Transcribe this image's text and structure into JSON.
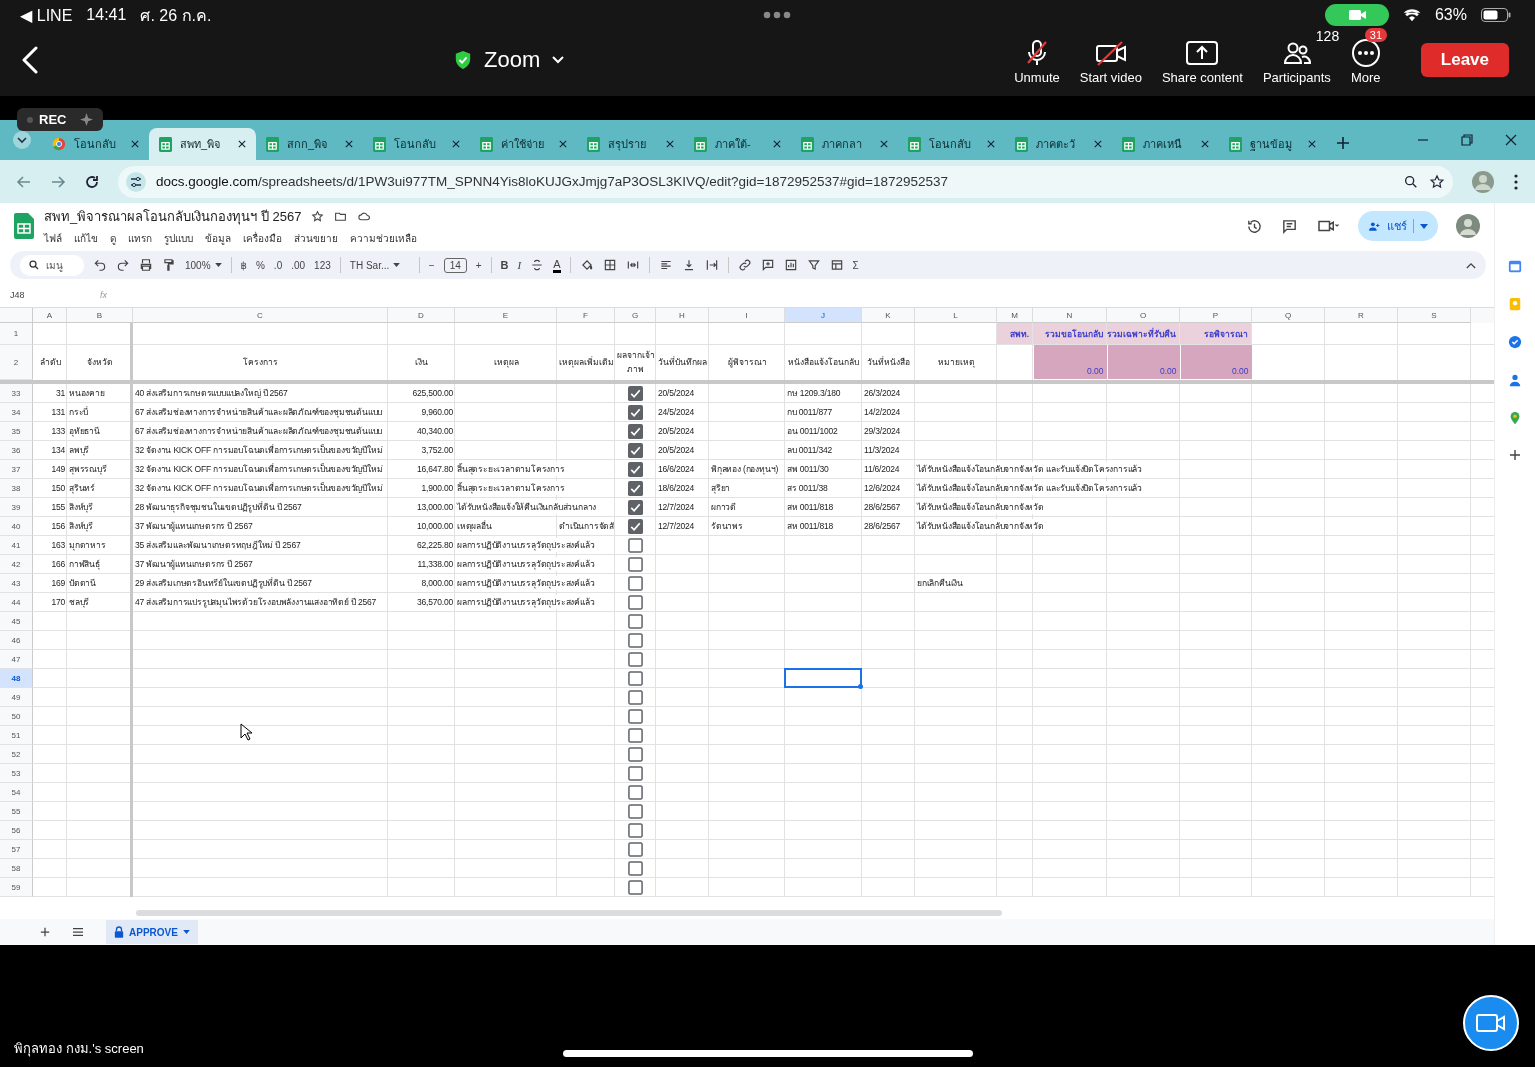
{
  "status_bar": {
    "back_app": "◀ LINE",
    "time": "14:41",
    "date": "ศ. 26 ก.ค.",
    "battery": "63%"
  },
  "zoom_bar": {
    "title": "Zoom",
    "controls": [
      {
        "kind": "mic",
        "label": "Unmute",
        "off": true
      },
      {
        "kind": "video",
        "label": "Start video",
        "off": true
      },
      {
        "kind": "share",
        "label": "Share content",
        "off": false
      },
      {
        "kind": "participants",
        "label": "Participants",
        "count": "128",
        "off": false
      },
      {
        "kind": "more",
        "label": "More",
        "badge": "31",
        "off": false
      }
    ],
    "leave": "Leave"
  },
  "rec_badge": "REC",
  "browser": {
    "tabs": [
      {
        "title": "โอนกลับ",
        "selected": false,
        "kind": "web"
      },
      {
        "title": "สพท_พิจ",
        "selected": true,
        "kind": "sheet"
      },
      {
        "title": "สกก_พิจ",
        "selected": false,
        "kind": "sheet"
      },
      {
        "title": "โอนกลับ",
        "selected": false,
        "kind": "sheet"
      },
      {
        "title": "ค่าใช้จ่าย",
        "selected": false,
        "kind": "sheet"
      },
      {
        "title": "สรุปราย",
        "selected": false,
        "kind": "sheet"
      },
      {
        "title": "ภาคใต้-",
        "selected": false,
        "kind": "sheet"
      },
      {
        "title": "ภาคกลา",
        "selected": false,
        "kind": "sheet"
      },
      {
        "title": "โอนกลับ",
        "selected": false,
        "kind": "sheet"
      },
      {
        "title": "ภาคตะวั",
        "selected": false,
        "kind": "sheet"
      },
      {
        "title": "ภาคเหนื",
        "selected": false,
        "kind": "sheet"
      },
      {
        "title": "ฐานข้อมู",
        "selected": false,
        "kind": "sheet"
      }
    ],
    "url_host": "docs.google.com",
    "url_path": "/spreadsheets/d/1PW3ui977TM_SPNN4Yis8loKUJGxJmjg7aP3OSL3KIVQ/edit?gid=1872952537#gid=1872952537"
  },
  "sheet": {
    "title": "สพท_พิจารณาผลโอนกลับเงินกองทุนฯ ปี 2567",
    "menu": [
      "ไฟล์",
      "แก้ไข",
      "ดู",
      "แทรก",
      "รูปแบบ",
      "ข้อมูล",
      "เครื่องมือ",
      "ส่วนขยาย",
      "ความช่วยเหลือ"
    ],
    "share": "แชร์",
    "toolbar": {
      "search": "เมนู",
      "zoom": "100%",
      "currency": "฿",
      "percent": "%",
      "dec_less": ".0",
      "dec_more": ".00",
      "format": "123",
      "font": "TH Sar...",
      "minus": "−",
      "size": "14",
      "plus": "+",
      "bold": "B",
      "italic": "I",
      "color_letter": "A",
      "functions": "Σ"
    },
    "name_box": "J48",
    "fx": "fx",
    "columns": [
      {
        "letter": "A",
        "selected": false,
        "kind": "number"
      },
      {
        "letter": "B",
        "selected": false,
        "kind": "text"
      },
      {
        "letter": "C",
        "selected": false,
        "kind": "text"
      },
      {
        "letter": "D",
        "selected": false,
        "kind": "number"
      },
      {
        "letter": "E",
        "selected": false,
        "kind": "text"
      },
      {
        "letter": "F",
        "selected": false,
        "kind": "text"
      },
      {
        "letter": "G",
        "selected": false,
        "kind": "checkbox"
      },
      {
        "letter": "H",
        "selected": false,
        "kind": "text"
      },
      {
        "letter": "I",
        "selected": false,
        "kind": "text"
      },
      {
        "letter": "J",
        "selected": true,
        "kind": "text"
      },
      {
        "letter": "K",
        "selected": false,
        "kind": "text"
      },
      {
        "letter": "L",
        "selected": false,
        "kind": "text"
      },
      {
        "letter": "M",
        "selected": false,
        "kind": "text"
      },
      {
        "letter": "N",
        "selected": false,
        "kind": "text"
      },
      {
        "letter": "O",
        "selected": false,
        "kind": "text"
      },
      {
        "letter": "P",
        "selected": false,
        "kind": "text"
      },
      {
        "letter": "Q",
        "selected": false,
        "kind": "text"
      },
      {
        "letter": "R",
        "selected": false,
        "kind": "text"
      },
      {
        "letter": "S",
        "selected": false,
        "kind": "text"
      }
    ],
    "header_row_numbers": [
      "1",
      "2"
    ],
    "summary_labels": {
      "M": "สพท.",
      "N": "รวมขอโอนกลับ",
      "O": "รวมเฉพาะที่รับคืน",
      "P": "รอพิจารณา"
    },
    "headings": {
      "A": "ลำดับ",
      "B": "จังหวัด",
      "C": "โครงการ",
      "D": "เงิน",
      "E": "เหตุผล",
      "F": "เหตุผลเพิ่มเติม",
      "G": "ผลจากเจ้า ภาพ",
      "H": "วันที่บันทึกผล",
      "I": "ผู้พิจารณา",
      "J": "หนังสือแจ้งโอนกลับ",
      "K": "วันที่หนังสือ",
      "L": "หมายเหตุ"
    },
    "summary_totals": {
      "N": "0.00",
      "O": "0.00",
      "P": "0.00"
    },
    "rows": [
      {
        "number": "33",
        "selected": false,
        "checked": true,
        "cells": {
          "A": "31",
          "B": "หนองคาย",
          "C": "40 ส่งเสริมการเกษตรแบบแปลงใหญ่ ปี 2567",
          "D": "625,500.00",
          "H": "20/5/2024",
          "J": "กษ 1209.3/180",
          "K": "26/3/2024"
        }
      },
      {
        "number": "34",
        "selected": false,
        "checked": true,
        "cells": {
          "A": "131",
          "B": "กระบี่",
          "C": "67 ส่งเสริมช่องทางการจำหน่ายสินค้าและผลิตภัณฑ์ของชุมชนต้นแบบ",
          "D": "9,960.00",
          "H": "24/5/2024",
          "J": "กบ 0011/877",
          "K": "14/2/2024"
        }
      },
      {
        "number": "35",
        "selected": false,
        "checked": true,
        "cells": {
          "A": "133",
          "B": "อุทัยธานี",
          "C": "67 ส่งเสริมช่องทางการจำหน่ายสินค้าและผลิตภัณฑ์ของชุมชนต้นแบบ",
          "D": "40,340.00",
          "H": "20/5/2024",
          "J": "อน 0011/1002",
          "K": "29/3/2024"
        }
      },
      {
        "number": "36",
        "selected": false,
        "checked": true,
        "cells": {
          "A": "134",
          "B": "ลพบุรี",
          "C": "32 จัดงาน KICK OFF การมอบโฉนดเพื่อการเกษตรเป็นของขวัญปีใหม่",
          "D": "3,752.00",
          "H": "20/5/2024",
          "J": "ลบ 0011/342",
          "K": "11/3/2024"
        }
      },
      {
        "number": "37",
        "selected": false,
        "checked": true,
        "cells": {
          "A": "149",
          "B": "สุพรรณบุรี",
          "C": "32 จัดงาน KICK OFF การมอบโฉนดเพื่อการเกษตรเป็นของขวัญปีใหม่",
          "D": "16,647.80",
          "E": "สิ้นสุดระยะเวลาตามโครงการ",
          "H": "16/6/2024",
          "I": "พิกุลทอง (กองทุนฯ)",
          "J": "สพ 0011/30",
          "K": "11/6/2024",
          "L": "ได้รับหนังสือแจ้งโอนกลับจากจังหวัด และรับแจ้งปิดโครงการแล้ว"
        }
      },
      {
        "number": "38",
        "selected": false,
        "checked": true,
        "cells": {
          "A": "150",
          "B": "สุรินทร์",
          "C": "32 จัดงาน KICK OFF การมอบโฉนดเพื่อการเกษตรเป็นของขวัญปีใหม่",
          "D": "1,900.00",
          "E": "สิ้นสุดระยะเวลาตามโครงการ",
          "H": "18/6/2024",
          "I": "สุริยา",
          "J": "สร 0011/38",
          "K": "12/6/2024",
          "L": "ได้รับหนังสือแจ้งโอนกลับจากจังหวัด และรับแจ้งปิดโครงการแล้ว"
        }
      },
      {
        "number": "39",
        "selected": false,
        "checked": true,
        "cells": {
          "A": "155",
          "B": "สิงห์บุรี",
          "C": "28 พัฒนาธุรกิจชุมชนในเขตปฏิรูปที่ดิน ปี  2567",
          "D": "13,000.00",
          "E": "ได้รับหนังสือแจ้งให้คืนเงินกลับส่วนกลาง",
          "H": "12/7/2024",
          "I": "ผกาวดี",
          "J": "สห 0011/818",
          "K": "28/6/2567",
          "L": "ได้รับหนังสือแจ้งโอนกลับจากจังหวัด"
        }
      },
      {
        "number": "40",
        "selected": false,
        "checked": true,
        "cells": {
          "A": "156",
          "B": "สิงห์บุรี",
          "C": "37 พัฒนาผู้แทนเกษตรกร ปี 2567",
          "D": "10,000.00",
          "E": "เหตุผลอื่น",
          "F": "ดำเนินการจัดสั",
          "H": "12/7/2024",
          "I": "รัตนาพร",
          "J": "สห 0011/818",
          "K": "28/6/2567",
          "L": "ได้รับหนังสือแจ้งโอนกลับจากจังหวัด"
        }
      },
      {
        "number": "41",
        "selected": false,
        "checked": false,
        "cells": {
          "A": "163",
          "B": "มุกดาหาร",
          "C": "35 ส่งเสริมและพัฒนาเกษตรทฤษฎีใหม่ ปี 2567",
          "D": "62,225.80",
          "E": "ผลการปฏิบัติงานบรรลุวัตถุประสงค์แล้ว"
        }
      },
      {
        "number": "42",
        "selected": false,
        "checked": false,
        "cells": {
          "A": "166",
          "B": "กาฬสินธุ์",
          "C": "37 พัฒนาผู้แทนเกษตรกร ปี 2567",
          "D": "11,338.00",
          "E": "ผลการปฏิบัติงานบรรลุวัตถุประสงค์แล้ว"
        }
      },
      {
        "number": "43",
        "selected": false,
        "checked": false,
        "cells": {
          "A": "169",
          "B": "ปัตตานี",
          "C": "29 ส่งเสริมเกษตรอินทรีย์ในเขตปฏิรูปที่ดิน ปี  2567",
          "D": "8,000.00",
          "E": "ผลการปฏิบัติงานบรรลุวัตถุประสงค์แล้ว",
          "L": "ยกเลิกคืนเงิน"
        }
      },
      {
        "number": "44",
        "selected": false,
        "checked": false,
        "cells": {
          "A": "170",
          "B": "ชลบุรี",
          "C": "47 ส่งเสริมการแปรรูปสมุนไพรด้วยโรงอบพลังงานแสงอาทิตย์ ปี 2567",
          "D": "36,570.00",
          "E": "ผลการปฏิบัติงานบรรลุวัตถุประสงค์แล้ว"
        }
      },
      {
        "number": "45",
        "selected": false,
        "checked": false
      },
      {
        "number": "46",
        "selected": false,
        "checked": false
      },
      {
        "number": "47",
        "selected": false,
        "checked": false
      },
      {
        "number": "48",
        "selected": true,
        "checked": false
      },
      {
        "number": "49",
        "selected": false,
        "checked": false
      },
      {
        "number": "50",
        "selected": false,
        "checked": false
      },
      {
        "number": "51",
        "selected": false,
        "checked": false
      },
      {
        "number": "52",
        "selected": false,
        "checked": false
      },
      {
        "number": "53",
        "selected": false,
        "checked": false
      },
      {
        "number": "54",
        "selected": false,
        "checked": false
      },
      {
        "number": "55",
        "selected": false,
        "checked": false
      },
      {
        "number": "56",
        "selected": false,
        "checked": false
      },
      {
        "number": "57",
        "selected": false,
        "checked": false
      },
      {
        "number": "58",
        "selected": false,
        "checked": false
      },
      {
        "number": "59",
        "selected": false,
        "checked": false
      }
    ],
    "sheet_tabs": [
      {
        "title": "APPROVE",
        "selected": true,
        "locked": true
      }
    ]
  },
  "screen_owner": "พิกุลทอง กงม.'s screen"
}
